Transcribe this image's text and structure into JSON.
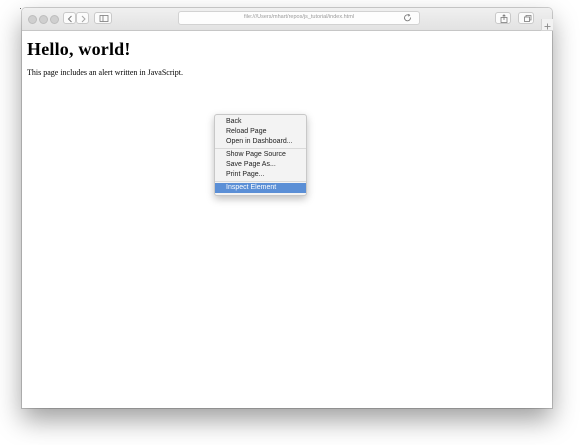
{
  "browser": {
    "url": "file:///Users/mhart/repos/js_tutorial/index.html"
  },
  "page": {
    "heading": "Hello, world!",
    "paragraph": "This page includes an alert written in JavaScript."
  },
  "context_menu": {
    "group1": [
      "Back",
      "Reload Page",
      "Open in Dashboard..."
    ],
    "group2": [
      "Show Page Source",
      "Save Page As...",
      "Print Page..."
    ],
    "group3": [
      "Inspect Element"
    ],
    "highlight_color": "#5b8fd6"
  }
}
